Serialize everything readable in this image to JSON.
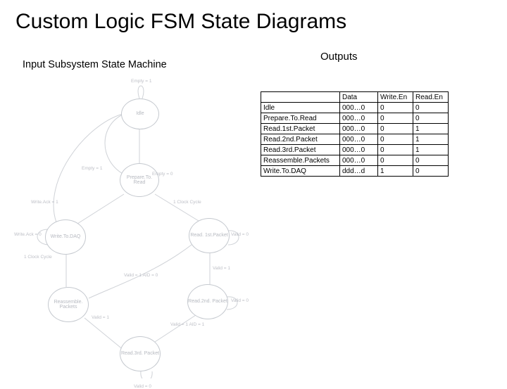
{
  "title": "Custom Logic FSM State Diagrams",
  "subtitle_left": "Input  Subsystem State Machine",
  "subtitle_right": "Outputs",
  "states": {
    "idle": "Idle",
    "prepare": "Prepare.To.\nRead",
    "writedaq": "Write.To.DAQ",
    "read1": "Read.\n1st.Packet",
    "reass": "Reassemble.\nPackets",
    "read2": "Read.2nd.\nPacket",
    "read3": "Read.3rd.\nPacket"
  },
  "edges": {
    "empty1": "Empty = 1",
    "empty0": "Empty = 0",
    "empty1b": "Empty = 1",
    "one_cycle_a": "1 Clock Cycle",
    "one_cycle_b": "1 Clock Cycle",
    "wack1": "Write.Ack = 1",
    "wack0": "Write.Ack = 0",
    "valid0_a": "Valid = 0",
    "valid1_a": "Valid = 1",
    "valid0_b": "Valid = 0",
    "valid1_b": "Valid = 1",
    "valid0_c": "Valid = 0",
    "valid1_c": "Valid = 1\nAID = 1",
    "valid1_d": "Valid = 1\nAID = 0"
  },
  "chart_data": {
    "type": "table",
    "title": "Outputs",
    "columns": [
      "",
      "Data",
      "Write.En",
      "Read.En"
    ],
    "rows": [
      {
        "state": "Idle",
        "data": "000…0",
        "wen": "0",
        "ren": "0"
      },
      {
        "state": "Prepare.To.Read",
        "data": "000…0",
        "wen": "0",
        "ren": "0"
      },
      {
        "state": "Read.1st.Packet",
        "data": "000…0",
        "wen": "0",
        "ren": "1"
      },
      {
        "state": "Read.2nd.Packet",
        "data": "000…0",
        "wen": "0",
        "ren": "1"
      },
      {
        "state": "Read.3rd.Packet",
        "data": "000…0",
        "wen": "0",
        "ren": "1"
      },
      {
        "state": "Reassemble.Packets",
        "data": "000…0",
        "wen": "0",
        "ren": "0"
      },
      {
        "state": "Write.To.DAQ",
        "data": "ddd…d",
        "wen": "1",
        "ren": "0"
      }
    ]
  }
}
